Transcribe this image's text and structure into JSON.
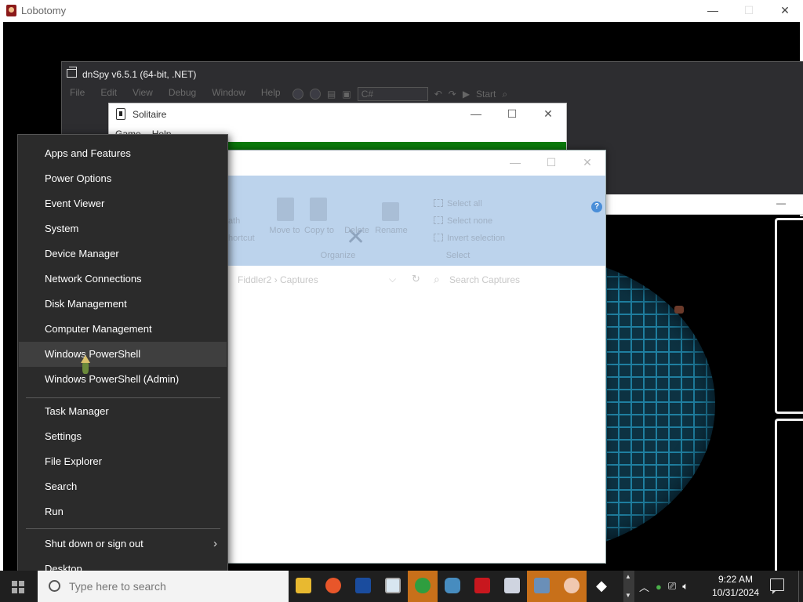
{
  "lobotomy": {
    "title": "Lobotomy",
    "controls": [
      "—",
      "☐",
      "✕"
    ]
  },
  "dnspy": {
    "title": "dnSpy v6.5.1 (64-bit, .NET)",
    "menu": [
      "File",
      "Edit",
      "View",
      "Debug",
      "Window",
      "Help"
    ],
    "language": "C#",
    "start_label": "Start"
  },
  "solitaire": {
    "title": "Solitaire",
    "menu": [
      "Game",
      "Help"
    ],
    "controls": [
      "—",
      "☐",
      "✕"
    ]
  },
  "explorer": {
    "controls": [
      "—",
      "☐",
      "✕"
    ],
    "ribbon": {
      "partial_labels": [
        "ath",
        "hortcut"
      ],
      "move_to": "Move to",
      "copy_to": "Copy to",
      "delete": "Delete",
      "rename": "Rename",
      "organize": "Organize",
      "select_all": "Select all",
      "select_none": "Select none",
      "invert_selection": "Invert selection",
      "select": "Select"
    },
    "path": "Fiddler2  ›  Captures",
    "search_placeholder": "Search Captures"
  },
  "winx_menu": {
    "group1": [
      "Apps and Features",
      "Power Options",
      "Event Viewer",
      "System",
      "Device Manager",
      "Network Connections",
      "Disk Management",
      "Computer Management",
      "Windows PowerShell",
      "Windows PowerShell (Admin)"
    ],
    "group2": [
      "Task Manager",
      "Settings",
      "File Explorer",
      "Search",
      "Run"
    ],
    "group3": [
      "Shut down or sign out",
      "Desktop"
    ],
    "highlighted": "Windows PowerShell"
  },
  "taskbar": {
    "search_placeholder": "Type here to search",
    "time": "9:22 AM",
    "date": "10/31/2024"
  },
  "colors": {
    "accent_active_app": "#c8701a",
    "menu_bg": "#2b2b2b",
    "ribbon_bg": "#bcd3ec"
  }
}
